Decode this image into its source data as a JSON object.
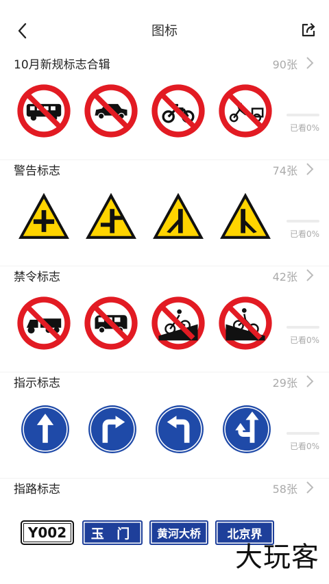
{
  "header": {
    "title": "图标"
  },
  "sections": [
    {
      "title": "10月新规标志合辑",
      "count": "90张",
      "progress_text": "已看0%",
      "progress": 0
    },
    {
      "title": "警告标志",
      "count": "74张",
      "progress_text": "已看0%",
      "progress": 0
    },
    {
      "title": "禁令标志",
      "count": "42张",
      "progress_text": "已看0%",
      "progress": 0
    },
    {
      "title": "指示标志",
      "count": "29张",
      "progress_text": "已看0%",
      "progress": 0
    },
    {
      "title": "指路标志",
      "count": "58张"
    }
  ],
  "route_signs": [
    "Y002",
    "玉 门",
    "黄河大桥",
    "北京界"
  ],
  "watermark": "大玩客",
  "colors": {
    "prohibit_red": "#e21b23",
    "warning_yellow": "#ffd400",
    "mandatory_blue": "#1f4aa8",
    "guide_blue": "#1e3f9a",
    "progress": "#3d86f5"
  }
}
